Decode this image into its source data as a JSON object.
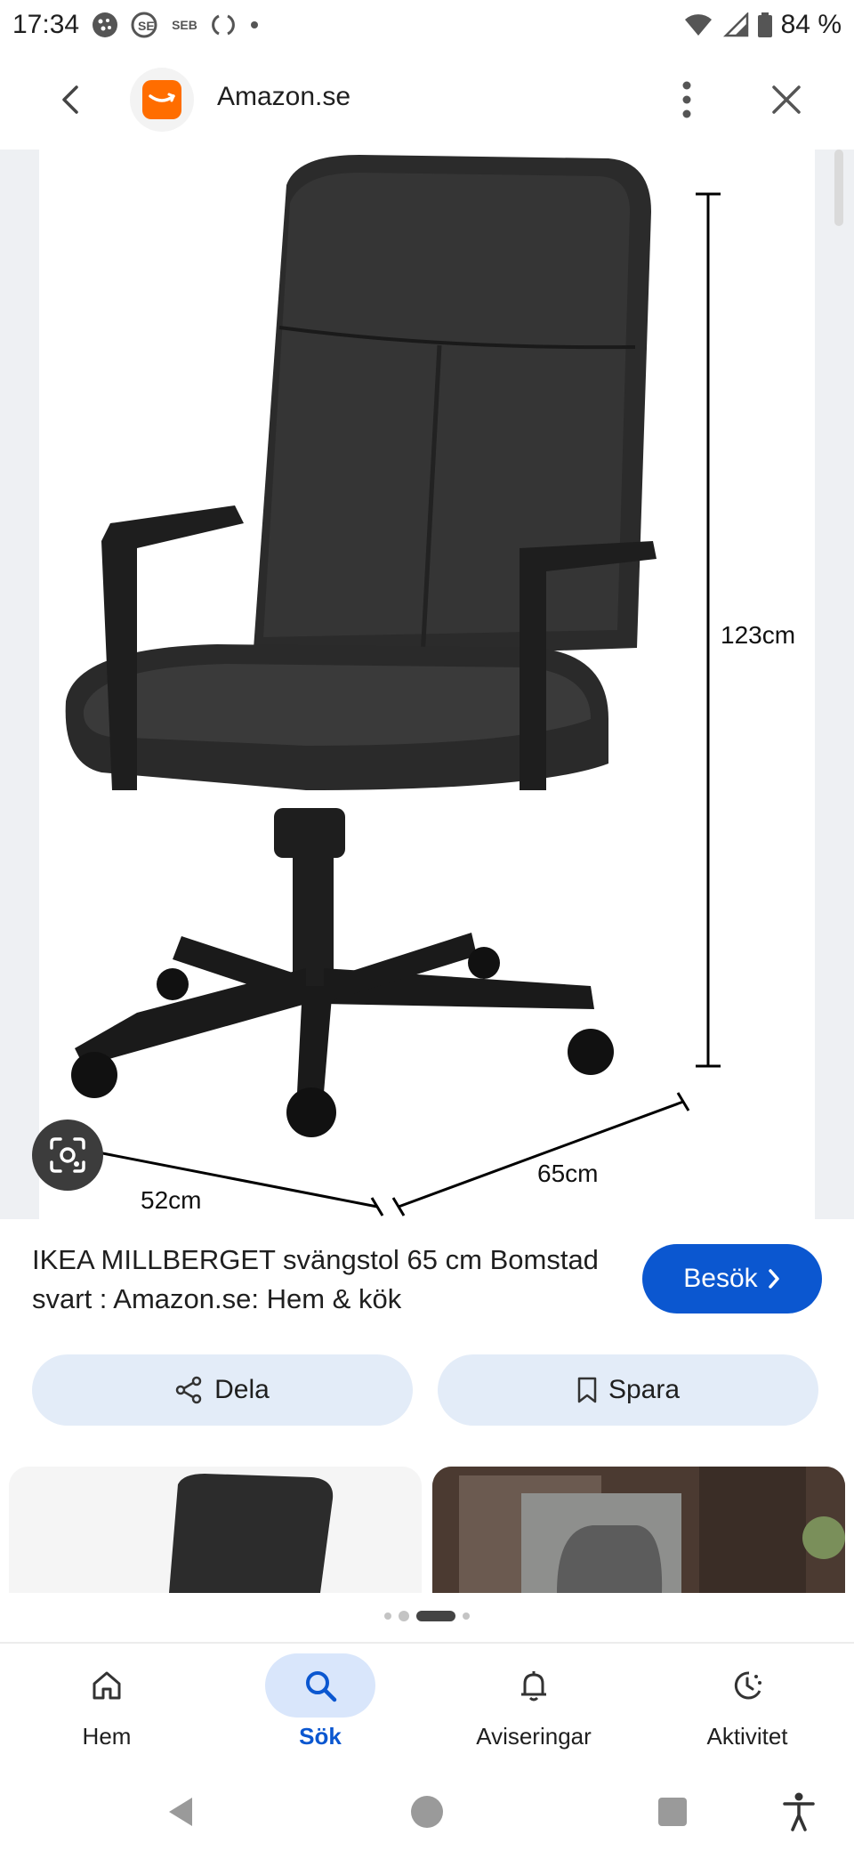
{
  "status_bar": {
    "time": "17:34",
    "battery": "84 %",
    "notif_seb": "SEB"
  },
  "header": {
    "site_name": "Amazon.se"
  },
  "product_image": {
    "height_label": "123cm",
    "depth_label": "65cm",
    "width_label": "52cm"
  },
  "result": {
    "title": "IKEA MILLBERGET svängstol 65 cm Bomstad svart : Amazon.se: Hem & kök",
    "visit_label": "Besök"
  },
  "actions": {
    "share_label": "Dela",
    "save_label": "Spara"
  },
  "pager": {
    "total": 4,
    "active_index": 2
  },
  "bottom_nav": {
    "items": [
      {
        "label": "Hem",
        "icon": "home-icon",
        "active": false
      },
      {
        "label": "Sök",
        "icon": "search-icon",
        "active": true
      },
      {
        "label": "Aviseringar",
        "icon": "bell-icon",
        "active": false
      },
      {
        "label": "Aktivitet",
        "icon": "activity-icon",
        "active": false
      }
    ]
  },
  "colors": {
    "accent": "#0b57d0",
    "pill_bg": "#e3ecf8",
    "brand_amazon": "#ff6d00"
  }
}
